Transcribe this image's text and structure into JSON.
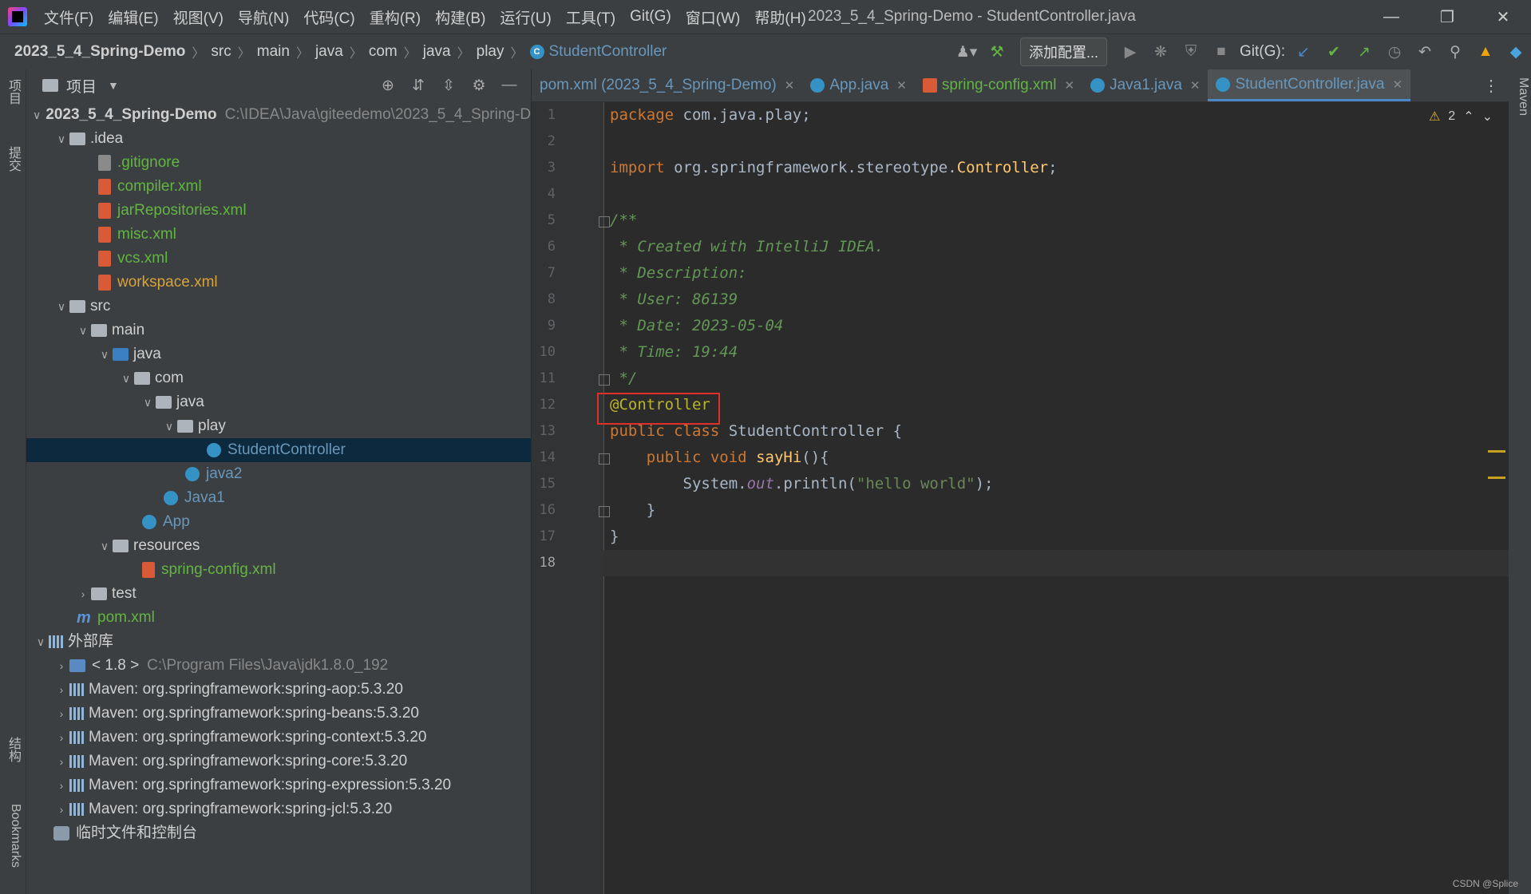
{
  "menubar": {
    "items": [
      "文件(F)",
      "编辑(E)",
      "视图(V)",
      "导航(N)",
      "代码(C)",
      "重构(R)",
      "构建(B)",
      "运行(U)",
      "工具(T)",
      "Git(G)",
      "窗口(W)",
      "帮助(H)"
    ],
    "window_title": "2023_5_4_Spring-Demo - StudentController.java"
  },
  "navbar": {
    "crumbs": [
      "2023_5_4_Spring-Demo",
      "src",
      "main",
      "java",
      "com",
      "java",
      "play",
      "StudentController"
    ],
    "add_config_label": "添加配置...",
    "git_label": "Git(G):"
  },
  "left_stripe": {
    "project_tab": "项目",
    "commit_tab": "提交",
    "structure_tab": "结构",
    "bookmarks_tab": "Bookmarks"
  },
  "right_stripe": {
    "maven_tab": "Maven"
  },
  "project_panel": {
    "title": "项目",
    "tree": [
      {
        "label": "2023_5_4_Spring-Demo",
        "path": "C:\\IDEA\\Java\\giteedemo\\2023_5_4_Spring-Demo"
      },
      {
        "label": ".idea"
      },
      {
        "label": ".gitignore"
      },
      {
        "label": "compiler.xml"
      },
      {
        "label": "jarRepositories.xml"
      },
      {
        "label": "misc.xml"
      },
      {
        "label": "vcs.xml"
      },
      {
        "label": "workspace.xml"
      },
      {
        "label": "src"
      },
      {
        "label": "main"
      },
      {
        "label": "java"
      },
      {
        "label": "com"
      },
      {
        "label": "java"
      },
      {
        "label": "play"
      },
      {
        "label": "StudentController"
      },
      {
        "label": "java2"
      },
      {
        "label": "Java1"
      },
      {
        "label": "App"
      },
      {
        "label": "resources"
      },
      {
        "label": "spring-config.xml"
      },
      {
        "label": "test"
      },
      {
        "label": "pom.xml"
      },
      {
        "label": "外部库"
      },
      {
        "label": "< 1.8 >",
        "path": "C:\\Program Files\\Java\\jdk1.8.0_192"
      },
      {
        "label": "Maven: org.springframework:spring-aop:5.3.20"
      },
      {
        "label": "Maven: org.springframework:spring-beans:5.3.20"
      },
      {
        "label": "Maven: org.springframework:spring-context:5.3.20"
      },
      {
        "label": "Maven: org.springframework:spring-core:5.3.20"
      },
      {
        "label": "Maven: org.springframework:spring-expression:5.3.20"
      },
      {
        "label": "Maven: org.springframework:spring-jcl:5.3.20"
      },
      {
        "label": "临时文件和控制台"
      }
    ]
  },
  "tabs": [
    {
      "label": "pom.xml (2023_5_4_Spring-Demo)"
    },
    {
      "label": "App.java"
    },
    {
      "label": "spring-config.xml"
    },
    {
      "label": "Java1.java"
    },
    {
      "label": "StudentController.java"
    }
  ],
  "editor": {
    "warning_count": "2",
    "lines": [
      {
        "n": "1",
        "t": "package com.java.play;"
      },
      {
        "n": "2",
        "t": ""
      },
      {
        "n": "3",
        "t": "import org.springframework.stereotype.Controller;"
      },
      {
        "n": "4",
        "t": ""
      },
      {
        "n": "5",
        "t": "/**"
      },
      {
        "n": "6",
        "t": " * Created with IntelliJ IDEA."
      },
      {
        "n": "7",
        "t": " * Description:"
      },
      {
        "n": "8",
        "t": " * User: 86139"
      },
      {
        "n": "9",
        "t": " * Date: 2023-05-04"
      },
      {
        "n": "10",
        "t": " * Time: 19:44"
      },
      {
        "n": "11",
        "t": " */"
      },
      {
        "n": "12",
        "t": "@Controller"
      },
      {
        "n": "13",
        "t": "public class StudentController {"
      },
      {
        "n": "14",
        "t": "    public void sayHi(){"
      },
      {
        "n": "15",
        "t": "        System.out.println(\"hello world\");"
      },
      {
        "n": "16",
        "t": "    }"
      },
      {
        "n": "17",
        "t": "}"
      },
      {
        "n": "18",
        "t": ""
      }
    ]
  },
  "watermark": "CSDN @Splice"
}
